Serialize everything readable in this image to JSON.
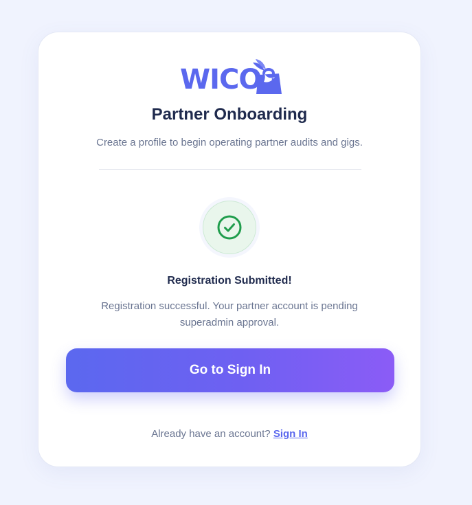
{
  "brand": {
    "name": "WICO",
    "logo_icon": "shopping-bag-bird-icon",
    "color": "#5b68ee"
  },
  "header": {
    "title": "Partner Onboarding",
    "subtitle": "Create a profile to begin operating partner audits and gigs."
  },
  "status": {
    "icon": "check-circle-icon",
    "title": "Registration Submitted!",
    "message": "Registration successful. Your partner account is pending superadmin approval.",
    "color": "#1f9d4c"
  },
  "actions": {
    "primary_label": "Go to Sign In"
  },
  "footer": {
    "prompt": "Already have an account?",
    "link_label": "Sign In"
  }
}
